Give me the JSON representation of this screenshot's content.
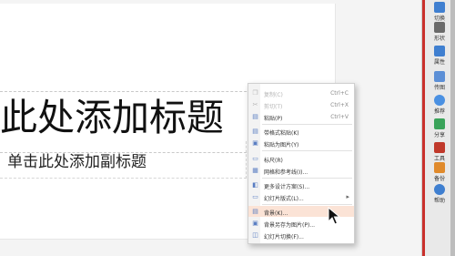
{
  "slide": {
    "title": "此处添加标题",
    "subtitle": "单击此处添加副标题"
  },
  "context_menu": {
    "items": [
      {
        "label": "复制(C)",
        "shortcut": "Ctrl+C",
        "icon": "copy-icon",
        "disabled": true
      },
      {
        "label": "剪切(T)",
        "shortcut": "Ctrl+X",
        "icon": "cut-icon",
        "disabled": true
      },
      {
        "label": "粘贴(P)",
        "shortcut": "Ctrl+V",
        "icon": "paste-icon",
        "disabled": false
      },
      {
        "label": "带格式粘贴(K)",
        "shortcut": "",
        "icon": "paste-format-icon",
        "disabled": false
      },
      {
        "label": "粘贴为图片(Y)",
        "shortcut": "",
        "icon": "paste-image-icon",
        "disabled": false
      },
      {
        "label": "标尺(R)",
        "shortcut": "",
        "icon": "ruler-icon",
        "disabled": false
      },
      {
        "label": "网格和参考线(I)...",
        "shortcut": "",
        "icon": "grid-icon",
        "disabled": false
      },
      {
        "label": "更多设计方案(S)...",
        "shortcut": "",
        "icon": "design-icon",
        "disabled": false
      },
      {
        "label": "幻灯片版式(L)...",
        "shortcut": "",
        "icon": "layout-icon",
        "disabled": false,
        "submenu": true
      },
      {
        "label": "背景(K)...",
        "shortcut": "",
        "icon": "background-icon",
        "disabled": false,
        "highlighted": true
      },
      {
        "label": "背景另存为图片(P)...",
        "shortcut": "",
        "icon": "save-background-icon",
        "disabled": false
      },
      {
        "label": "幻灯片切换(F)...",
        "shortcut": "",
        "icon": "transition-icon",
        "disabled": false
      }
    ]
  },
  "right_panel": {
    "items": [
      {
        "label": "切换",
        "icon": "switch-icon",
        "color": "#3f7fd0"
      },
      {
        "label": "形状",
        "icon": "shape-icon",
        "color": "#6a6a6a"
      },
      {
        "label": "属性",
        "icon": "property-icon",
        "color": "#3f7fd0"
      },
      {
        "label": "传图",
        "icon": "upload-image-icon",
        "color": "#5c8fd6"
      },
      {
        "label": "推荐",
        "icon": "recommend-icon",
        "color": "#4a90e2"
      },
      {
        "label": "分享",
        "icon": "share-icon",
        "color": "#3aa35a"
      },
      {
        "label": "工具",
        "icon": "tools-icon",
        "color": "#c0392b"
      },
      {
        "label": "备份",
        "icon": "backup-icon",
        "color": "#e08a2c"
      },
      {
        "label": "帮助",
        "icon": "help-icon",
        "color": "#3f7fd0"
      }
    ]
  },
  "colors": {
    "menu_highlight": "#fbe3d6",
    "accent_red": "#c9302c"
  }
}
